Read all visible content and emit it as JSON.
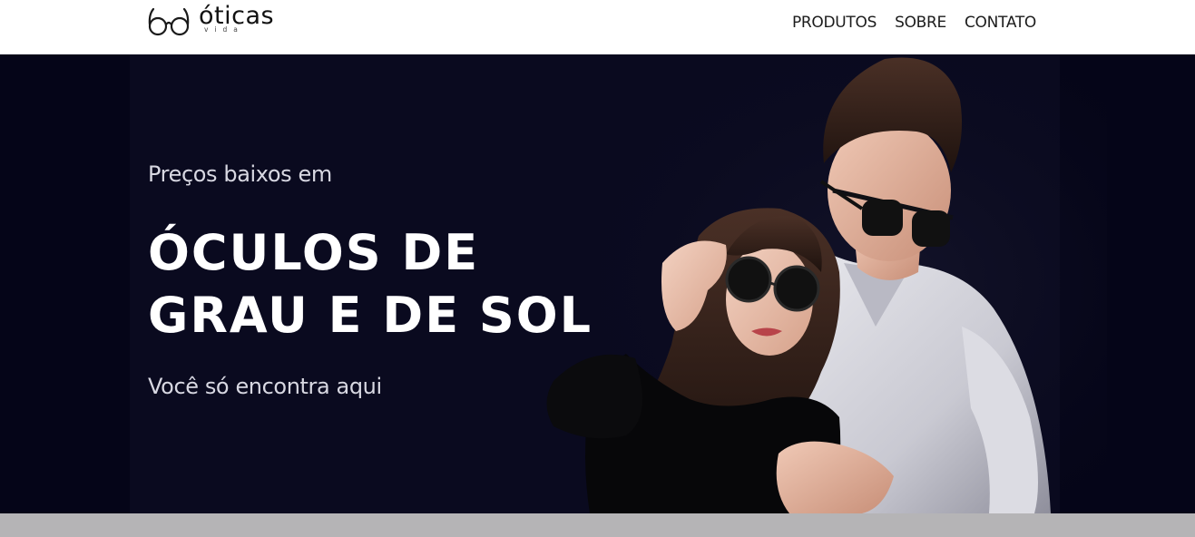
{
  "brand": {
    "name": "óticas",
    "sub": "vida",
    "logo_icon": "glasses-icon"
  },
  "nav": {
    "items": [
      {
        "label": "PRODUTOS"
      },
      {
        "label": "SOBRE"
      },
      {
        "label": "CONTATO"
      }
    ]
  },
  "hero": {
    "pre": "Preços baixos em",
    "title_line1": "ÓCULOS DE",
    "title_line2": "GRAU E DE SOL",
    "post": "Você só encontra aqui",
    "image": "couple-wearing-sunglasses"
  },
  "colors": {
    "hero_bg": "#050518",
    "panel_bg": "#0a0a1f",
    "header_bg": "#ffffff",
    "footer_band": "#b5b4b6"
  }
}
